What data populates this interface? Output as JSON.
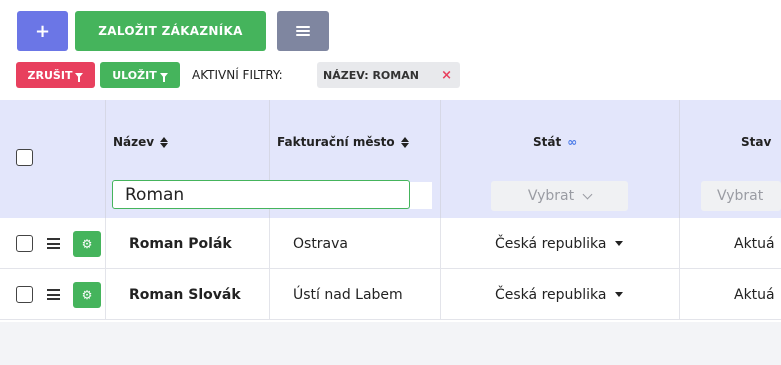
{
  "toolbar": {
    "add_label": "+",
    "create_label": "ZALOŽIT ZÁKAZNÍKA",
    "cancel_label": "ZRUŠIT",
    "save_label": "ULOŽIT",
    "filters_label": "AKTIVNÍ FILTRY:",
    "active_filter": "NÁZEV: ROMAN",
    "remove_icon": "×"
  },
  "table": {
    "columns": [
      {
        "label": "Název"
      },
      {
        "label": "Fakturační město"
      },
      {
        "label": "Stát"
      },
      {
        "label": "Stav"
      }
    ],
    "filters": {
      "name_value": "Roman",
      "state_placeholder": "Vybrat",
      "status_placeholder": "Vybrat"
    },
    "rows": [
      {
        "name": "Roman Polák",
        "city": "Ostrava",
        "country": "Česká republika",
        "status": "Aktuá"
      },
      {
        "name": "Roman Slovák",
        "city": "Ústí nad Labem",
        "country": "Česká republika",
        "status": "Aktuá"
      }
    ]
  },
  "colors": {
    "primary": "#6b76e6",
    "success": "#45b45c",
    "danger": "#e8405e",
    "secondary": "#7f86a0",
    "header_bg": "#e3e6fb"
  }
}
